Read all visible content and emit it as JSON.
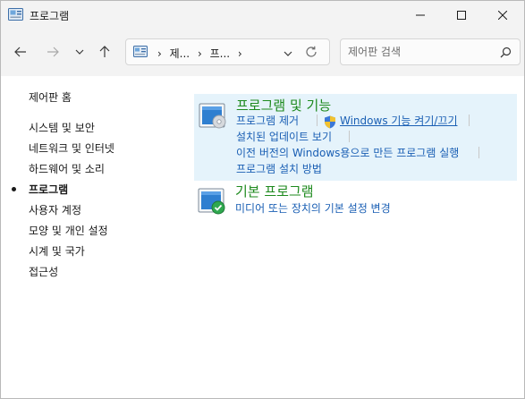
{
  "window": {
    "title": "프로그램"
  },
  "address": {
    "crumbs": [
      "제...",
      "프...",
      ""
    ],
    "chevron": "›"
  },
  "search": {
    "placeholder": "제어판 검색"
  },
  "leftnav": {
    "home": "제어판 홈",
    "items": [
      {
        "label": "시스템 및 보안",
        "active": false
      },
      {
        "label": "네트워크 및 인터넷",
        "active": false
      },
      {
        "label": "하드웨어 및 소리",
        "active": false
      },
      {
        "label": "프로그램",
        "active": true
      },
      {
        "label": "사용자 계정",
        "active": false
      },
      {
        "label": "모양 및 개인 설정",
        "active": false
      },
      {
        "label": "시계 및 국가",
        "active": false
      },
      {
        "label": "접근성",
        "active": false
      }
    ]
  },
  "groups": {
    "programs_features": {
      "title": "프로그램 및 기능",
      "links": {
        "uninstall": "프로그램 제거",
        "windows_features": "Windows 기능 켜기/끄기",
        "installed_updates": "설치된 업데이트 보기",
        "compat": "이전 버전의 Windows용으로 만든 프로그램 실행",
        "how_to_install": "프로그램 설치 방법"
      }
    },
    "default_programs": {
      "title": "기본 프로그램",
      "links": {
        "autoplay": "미디어 또는 장치의 기본 설정 변경"
      }
    }
  },
  "colors": {
    "accent_link": "#1a5fb4",
    "group_title": "#1e8a1e",
    "highlight": "#e5f3fb"
  }
}
